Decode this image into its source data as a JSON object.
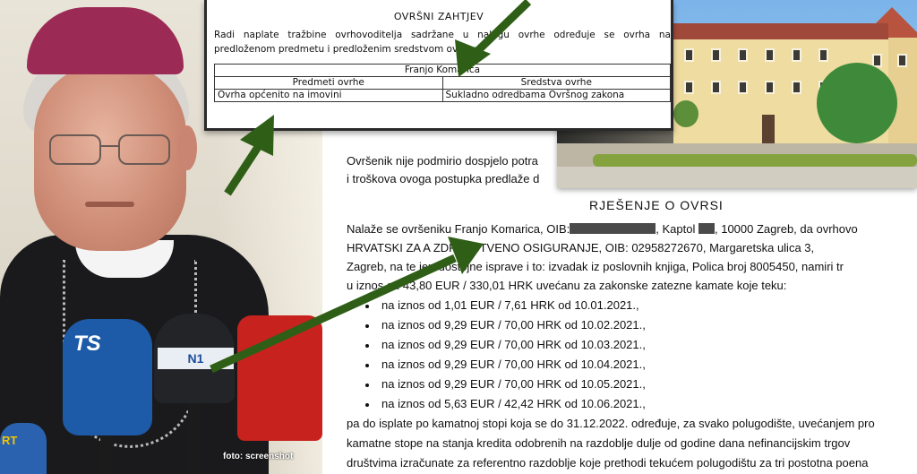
{
  "photo": {
    "credit": "foto: screenshot",
    "mic_labels": [
      "TS",
      "N1",
      "RT"
    ]
  },
  "top_document": {
    "title": "OVRŠNI ZAHTJEV",
    "paragraph": "Radi naplate tražbine ovrhovoditelja sadržane u nalogu ovrhe                     određuje se ovrha na predloženom predmetu i predloženim sredstvom ovrhe:",
    "table": {
      "party": "Franjo Komarica",
      "headers": [
        "Predmeti ovrhe",
        "Sredstva ovrhe"
      ],
      "row": [
        "Ovrha općenito na imovini",
        "Sukladno odredbama Ovršnog zakona"
      ]
    }
  },
  "document": {
    "line1": "Ovršenik nije podmirio dospjelo potra",
    "line2": "i troškova ovoga postupka predlaže d",
    "heading": "RJEŠENJE O OVRSI",
    "p1_a": "Nalaže se ovršeniku Franjo Komarica, OIB:",
    "p1_b": ", Kaptol",
    "p1_c": ", 10000 Zagreb, da ovrhovo",
    "p2": "HRVATSKI ZA      A ZDRAVSTVENO OSIGURANJE, OIB: 02958272670, Margaretska ulica 3,",
    "p3": "Zagreb, na te           jerodostojne isprave i to: izvadak iz poslovnih knjiga, Polica broj 8005450, namiri tr",
    "p4": "u iznos   od 43,80 EUR / 330,01 HRK uvećanu za zakonske zatezne kamate koje teku:",
    "bullets": [
      "na iznos od 1,01 EUR / 7,61 HRK od 10.01.2021.,",
      "na iznos od 9,29 EUR / 70,00 HRK od 10.02.2021.,",
      "na iznos od 9,29 EUR / 70,00 HRK od 10.03.2021.,",
      "na iznos od 9,29 EUR / 70,00 HRK od 10.04.2021.,",
      "na iznos od 9,29 EUR / 70,00 HRK od 10.05.2021.,",
      "na iznos od 5,63 EUR / 42,42 HRK od 10.06.2021.,"
    ],
    "p5": "pa do isplate po kamatnoj stopi koja se do 31.12.2022. određuje, za svako polugodište, uvećanjem pro",
    "p6": "kamatne stope na stanja kredita odobrenih na razdoblje dulje od godine dana nefinancijskim trgov",
    "p7": "društvima izračunate za referentno razdoblje koje prethodi tekućem polugodištu za tri postotna poena"
  },
  "colors": {
    "arrow": "#2f5f17",
    "zucchetto": "#9b2a55",
    "text": "#111111"
  }
}
